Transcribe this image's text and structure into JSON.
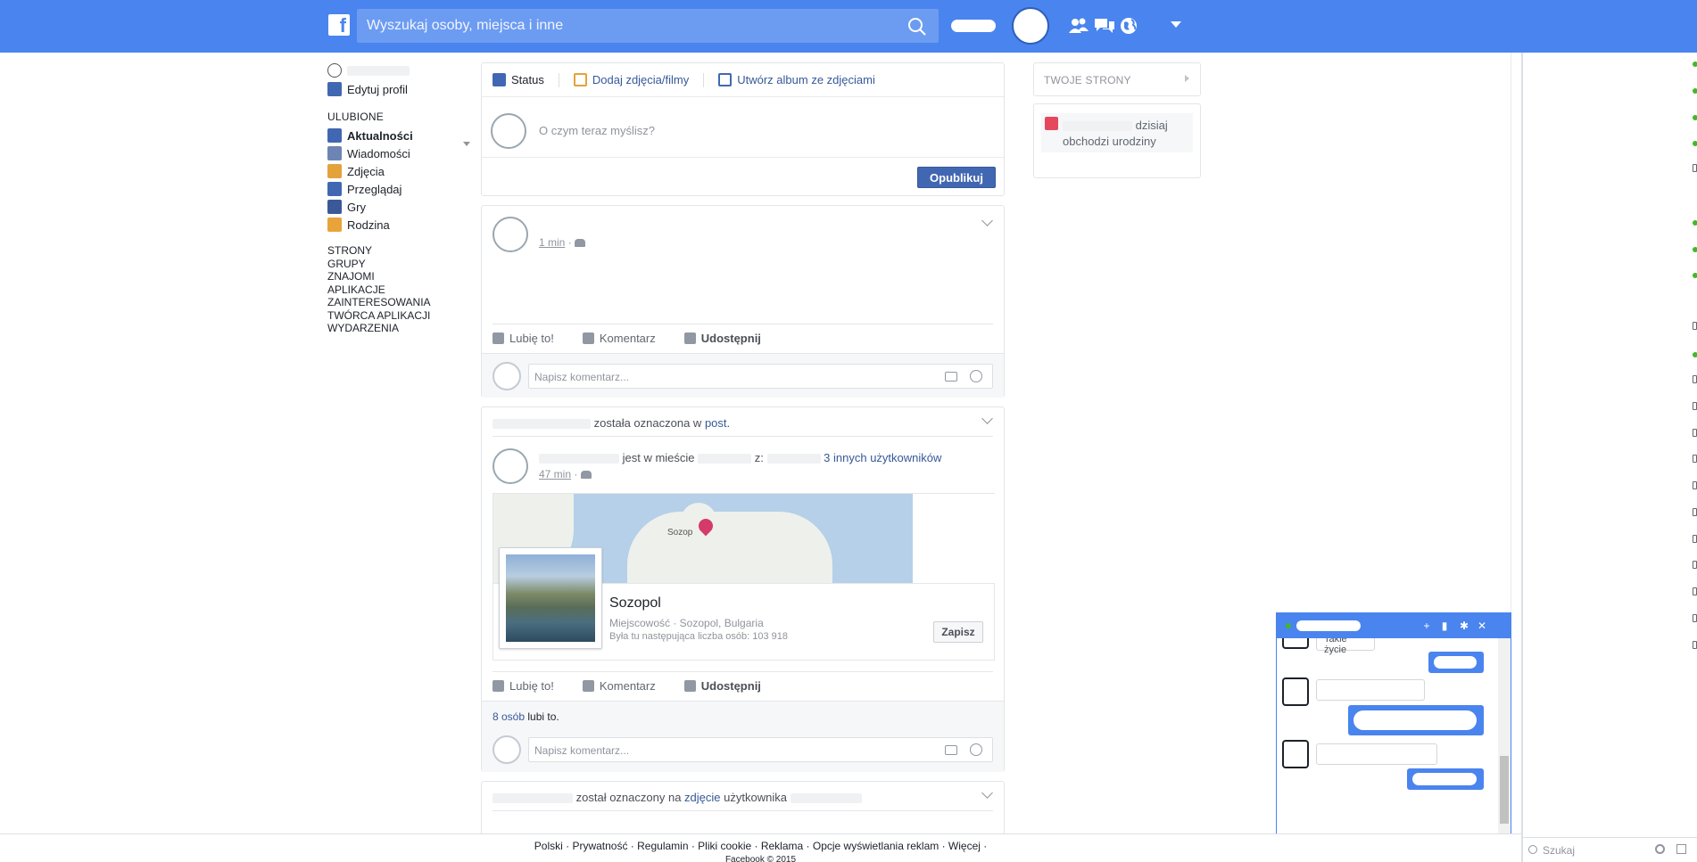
{
  "header": {
    "search_placeholder": "Wyszukaj osoby, miejsca i inne",
    "logo": "f"
  },
  "leftnav": {
    "edit_profile": "Edytuj profil",
    "favorites_heading": "ULUBIONE",
    "items": [
      {
        "label": "Aktualności",
        "icon": "news-feed-icon",
        "color": "#4267b2"
      },
      {
        "label": "Wiadomości",
        "icon": "messages-icon",
        "color": "#6d84b4"
      },
      {
        "label": "Zdjęcia",
        "icon": "photos-icon",
        "color": "#e4a23a"
      },
      {
        "label": "Przeglądaj",
        "icon": "browse-icon",
        "color": "#4267b2"
      },
      {
        "label": "Gry",
        "icon": "games-icon",
        "color": "#3b5998"
      },
      {
        "label": "Rodzina",
        "icon": "family-icon",
        "color": "#e8a33a"
      }
    ],
    "sections": [
      "STRONY",
      "GRUPY",
      "ZNAJOMI",
      "APLIKACJE",
      "ZAINTERESOWANIA",
      "TWÓRCA APLIKACJI",
      "WYDARZENIA"
    ]
  },
  "composer": {
    "tab_status": "Status",
    "tab_photos": "Dodaj zdjęcia/filmy",
    "tab_album": "Utwórz album ze zdjęciami",
    "placeholder": "O czym teraz myślisz?",
    "publish": "Opublikuj"
  },
  "post1": {
    "time": "1 min",
    "like": "Lubię to!",
    "comment": "Komentarz",
    "share": "Udostępnij",
    "comment_placeholder": "Napisz komentarz..."
  },
  "post2": {
    "tag_text": "została oznaczona w",
    "tag_link": "post",
    "checkin_text": "jest w mieście",
    "with_text": "z:",
    "others_link": "3 innych użytkowników",
    "time": "47 min",
    "place_name": "Sozopol",
    "map_label": "Sozop",
    "place_type": "Miejscowość · Sozopol, Bulgaria",
    "place_visits": "Była tu następująca liczba osób: 103 918",
    "save": "Zapisz",
    "like": "Lubię to!",
    "comment": "Komentarz",
    "share": "Udostępnij",
    "likes_count_link": "8 osób",
    "likes_text": "lubi to.",
    "comment_placeholder": "Napisz komentarz..."
  },
  "post3": {
    "tag_text": "został oznaczony na",
    "tag_link": "zdjęcie",
    "tag_suffix": "użytkownika"
  },
  "rightcol": {
    "pages_heading": "TWOJE STRONY",
    "birthday_today": "dzisiaj",
    "birthday_text": "obchodzi urodziny"
  },
  "chat": {
    "partial_msg": "Takie życie",
    "search_placeholder": "Szukaj"
  },
  "footer": {
    "links": "Polski · Prywatność · Regulamin · Pliki cookie · Reklama · Opcje wyświetlania reklam · Więcej ·",
    "copyright": "Facebook © 2015"
  },
  "colors": {
    "topbar": "#4a84ee",
    "link": "#365899",
    "online": "#42b72a"
  }
}
